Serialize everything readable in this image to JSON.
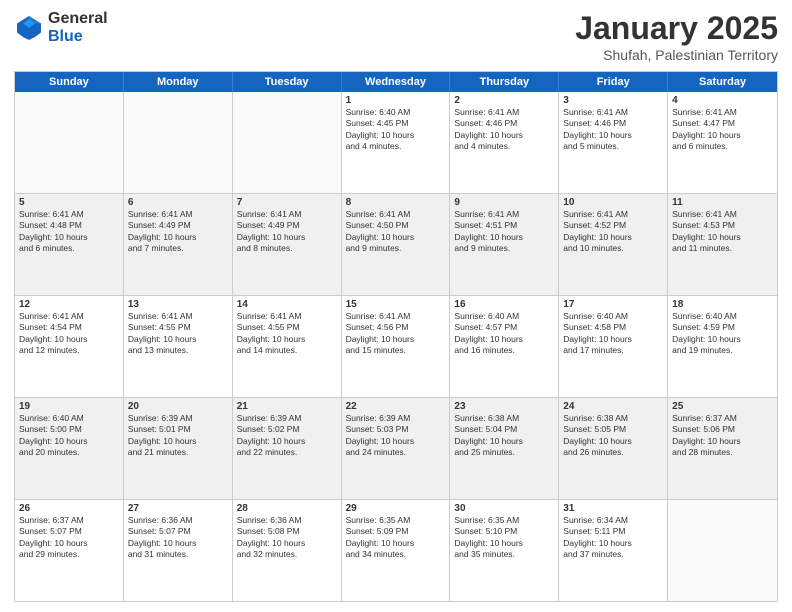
{
  "logo": {
    "general": "General",
    "blue": "Blue"
  },
  "title": "January 2025",
  "location": "Shufah, Palestinian Territory",
  "weekdays": [
    "Sunday",
    "Monday",
    "Tuesday",
    "Wednesday",
    "Thursday",
    "Friday",
    "Saturday"
  ],
  "rows": [
    [
      {
        "day": "",
        "sunrise": "",
        "sunset": "",
        "daylight": "",
        "empty": true
      },
      {
        "day": "",
        "sunrise": "",
        "sunset": "",
        "daylight": "",
        "empty": true
      },
      {
        "day": "",
        "sunrise": "",
        "sunset": "",
        "daylight": "",
        "empty": true
      },
      {
        "day": "1",
        "sunrise": "Sunrise: 6:40 AM",
        "sunset": "Sunset: 4:45 PM",
        "daylight": "Daylight: 10 hours",
        "daylight2": "and 4 minutes.",
        "empty": false
      },
      {
        "day": "2",
        "sunrise": "Sunrise: 6:41 AM",
        "sunset": "Sunset: 4:46 PM",
        "daylight": "Daylight: 10 hours",
        "daylight2": "and 4 minutes.",
        "empty": false
      },
      {
        "day": "3",
        "sunrise": "Sunrise: 6:41 AM",
        "sunset": "Sunset: 4:46 PM",
        "daylight": "Daylight: 10 hours",
        "daylight2": "and 5 minutes.",
        "empty": false
      },
      {
        "day": "4",
        "sunrise": "Sunrise: 6:41 AM",
        "sunset": "Sunset: 4:47 PM",
        "daylight": "Daylight: 10 hours",
        "daylight2": "and 6 minutes.",
        "empty": false
      }
    ],
    [
      {
        "day": "5",
        "sunrise": "Sunrise: 6:41 AM",
        "sunset": "Sunset: 4:48 PM",
        "daylight": "Daylight: 10 hours",
        "daylight2": "and 6 minutes.",
        "empty": false
      },
      {
        "day": "6",
        "sunrise": "Sunrise: 6:41 AM",
        "sunset": "Sunset: 4:49 PM",
        "daylight": "Daylight: 10 hours",
        "daylight2": "and 7 minutes.",
        "empty": false
      },
      {
        "day": "7",
        "sunrise": "Sunrise: 6:41 AM",
        "sunset": "Sunset: 4:49 PM",
        "daylight": "Daylight: 10 hours",
        "daylight2": "and 8 minutes.",
        "empty": false
      },
      {
        "day": "8",
        "sunrise": "Sunrise: 6:41 AM",
        "sunset": "Sunset: 4:50 PM",
        "daylight": "Daylight: 10 hours",
        "daylight2": "and 9 minutes.",
        "empty": false
      },
      {
        "day": "9",
        "sunrise": "Sunrise: 6:41 AM",
        "sunset": "Sunset: 4:51 PM",
        "daylight": "Daylight: 10 hours",
        "daylight2": "and 9 minutes.",
        "empty": false
      },
      {
        "day": "10",
        "sunrise": "Sunrise: 6:41 AM",
        "sunset": "Sunset: 4:52 PM",
        "daylight": "Daylight: 10 hours",
        "daylight2": "and 10 minutes.",
        "empty": false
      },
      {
        "day": "11",
        "sunrise": "Sunrise: 6:41 AM",
        "sunset": "Sunset: 4:53 PM",
        "daylight": "Daylight: 10 hours",
        "daylight2": "and 11 minutes.",
        "empty": false
      }
    ],
    [
      {
        "day": "12",
        "sunrise": "Sunrise: 6:41 AM",
        "sunset": "Sunset: 4:54 PM",
        "daylight": "Daylight: 10 hours",
        "daylight2": "and 12 minutes.",
        "empty": false
      },
      {
        "day": "13",
        "sunrise": "Sunrise: 6:41 AM",
        "sunset": "Sunset: 4:55 PM",
        "daylight": "Daylight: 10 hours",
        "daylight2": "and 13 minutes.",
        "empty": false
      },
      {
        "day": "14",
        "sunrise": "Sunrise: 6:41 AM",
        "sunset": "Sunset: 4:55 PM",
        "daylight": "Daylight: 10 hours",
        "daylight2": "and 14 minutes.",
        "empty": false
      },
      {
        "day": "15",
        "sunrise": "Sunrise: 6:41 AM",
        "sunset": "Sunset: 4:56 PM",
        "daylight": "Daylight: 10 hours",
        "daylight2": "and 15 minutes.",
        "empty": false
      },
      {
        "day": "16",
        "sunrise": "Sunrise: 6:40 AM",
        "sunset": "Sunset: 4:57 PM",
        "daylight": "Daylight: 10 hours",
        "daylight2": "and 16 minutes.",
        "empty": false
      },
      {
        "day": "17",
        "sunrise": "Sunrise: 6:40 AM",
        "sunset": "Sunset: 4:58 PM",
        "daylight": "Daylight: 10 hours",
        "daylight2": "and 17 minutes.",
        "empty": false
      },
      {
        "day": "18",
        "sunrise": "Sunrise: 6:40 AM",
        "sunset": "Sunset: 4:59 PM",
        "daylight": "Daylight: 10 hours",
        "daylight2": "and 19 minutes.",
        "empty": false
      }
    ],
    [
      {
        "day": "19",
        "sunrise": "Sunrise: 6:40 AM",
        "sunset": "Sunset: 5:00 PM",
        "daylight": "Daylight: 10 hours",
        "daylight2": "and 20 minutes.",
        "empty": false
      },
      {
        "day": "20",
        "sunrise": "Sunrise: 6:39 AM",
        "sunset": "Sunset: 5:01 PM",
        "daylight": "Daylight: 10 hours",
        "daylight2": "and 21 minutes.",
        "empty": false
      },
      {
        "day": "21",
        "sunrise": "Sunrise: 6:39 AM",
        "sunset": "Sunset: 5:02 PM",
        "daylight": "Daylight: 10 hours",
        "daylight2": "and 22 minutes.",
        "empty": false
      },
      {
        "day": "22",
        "sunrise": "Sunrise: 6:39 AM",
        "sunset": "Sunset: 5:03 PM",
        "daylight": "Daylight: 10 hours",
        "daylight2": "and 24 minutes.",
        "empty": false
      },
      {
        "day": "23",
        "sunrise": "Sunrise: 6:38 AM",
        "sunset": "Sunset: 5:04 PM",
        "daylight": "Daylight: 10 hours",
        "daylight2": "and 25 minutes.",
        "empty": false
      },
      {
        "day": "24",
        "sunrise": "Sunrise: 6:38 AM",
        "sunset": "Sunset: 5:05 PM",
        "daylight": "Daylight: 10 hours",
        "daylight2": "and 26 minutes.",
        "empty": false
      },
      {
        "day": "25",
        "sunrise": "Sunrise: 6:37 AM",
        "sunset": "Sunset: 5:06 PM",
        "daylight": "Daylight: 10 hours",
        "daylight2": "and 28 minutes.",
        "empty": false
      }
    ],
    [
      {
        "day": "26",
        "sunrise": "Sunrise: 6:37 AM",
        "sunset": "Sunset: 5:07 PM",
        "daylight": "Daylight: 10 hours",
        "daylight2": "and 29 minutes.",
        "empty": false
      },
      {
        "day": "27",
        "sunrise": "Sunrise: 6:36 AM",
        "sunset": "Sunset: 5:07 PM",
        "daylight": "Daylight: 10 hours",
        "daylight2": "and 31 minutes.",
        "empty": false
      },
      {
        "day": "28",
        "sunrise": "Sunrise: 6:36 AM",
        "sunset": "Sunset: 5:08 PM",
        "daylight": "Daylight: 10 hours",
        "daylight2": "and 32 minutes.",
        "empty": false
      },
      {
        "day": "29",
        "sunrise": "Sunrise: 6:35 AM",
        "sunset": "Sunset: 5:09 PM",
        "daylight": "Daylight: 10 hours",
        "daylight2": "and 34 minutes.",
        "empty": false
      },
      {
        "day": "30",
        "sunrise": "Sunrise: 6:35 AM",
        "sunset": "Sunset: 5:10 PM",
        "daylight": "Daylight: 10 hours",
        "daylight2": "and 35 minutes.",
        "empty": false
      },
      {
        "day": "31",
        "sunrise": "Sunrise: 6:34 AM",
        "sunset": "Sunset: 5:11 PM",
        "daylight": "Daylight: 10 hours",
        "daylight2": "and 37 minutes.",
        "empty": false
      },
      {
        "day": "",
        "sunrise": "",
        "sunset": "",
        "daylight": "",
        "daylight2": "",
        "empty": true
      }
    ]
  ]
}
